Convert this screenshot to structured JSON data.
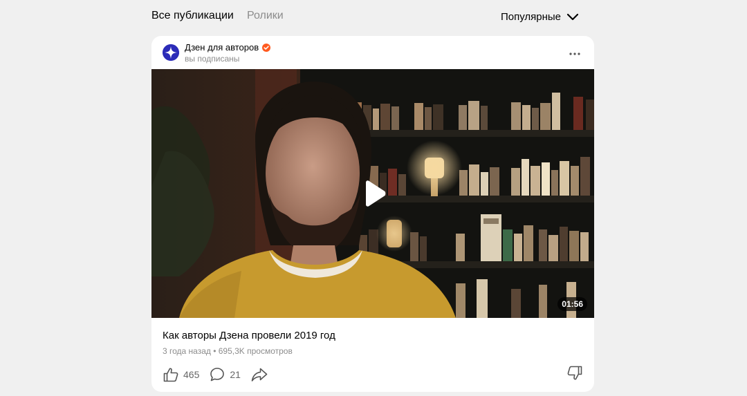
{
  "tabs": [
    {
      "label": "Все публикации",
      "active": true
    },
    {
      "label": "Ролики",
      "active": false
    }
  ],
  "sort": {
    "label": "Популярные",
    "icon": "chevron-down-icon"
  },
  "post": {
    "channel": {
      "name": "Дзен для авторов",
      "verified": true,
      "subscription_status": "вы подписаны",
      "avatar_icon": "zen-star-icon"
    },
    "menu_icon": "more-dots-icon",
    "video": {
      "duration": "01:56",
      "play_icon": "play-icon"
    },
    "title": "Как авторы Дзена провели 2019 год",
    "meta": "3 года назад • 695,3K просмотров",
    "actions": {
      "likes": "465",
      "comments": "21",
      "like_icon": "thumb-up-icon",
      "comment_icon": "comment-icon",
      "share_icon": "share-icon",
      "dislike_icon": "thumb-down-icon"
    }
  },
  "colors": {
    "page_background": "#f0f0f0",
    "card_background": "#ffffff",
    "verified_badge": "#ff5a1f",
    "avatar": "#2b2bb8",
    "muted_text": "#8c8c8c"
  }
}
